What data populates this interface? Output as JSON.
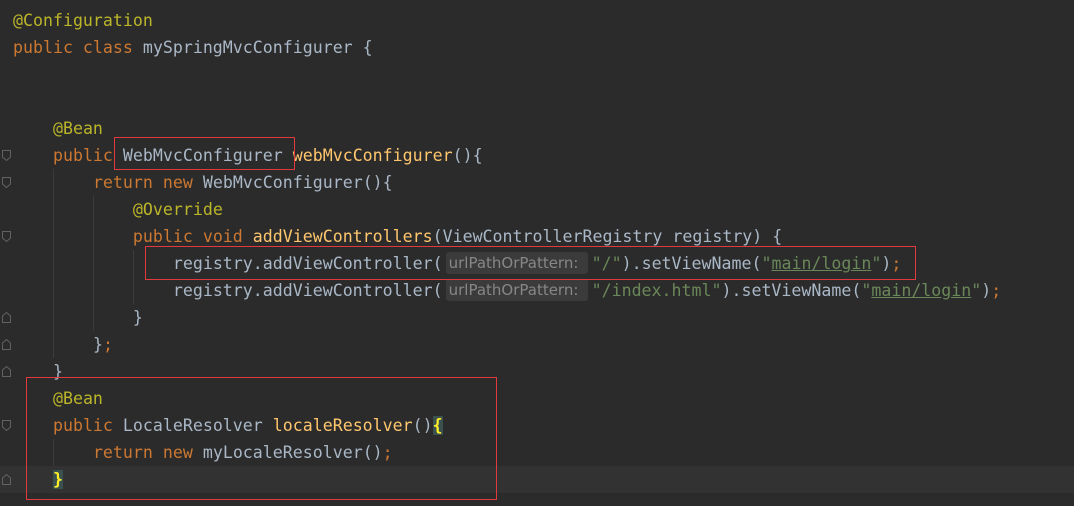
{
  "theme": {
    "background": "#2B2B2B",
    "caret_line": "#323232",
    "plain": "#A9B7C6",
    "keyword": "#CC7832",
    "annotation": "#BBB529",
    "method": "#FFC66D",
    "string": "#6A8759",
    "semicolon": "#CC7832",
    "hint_text": "#878787",
    "hint_bg": "#3B3B3B",
    "brace_text": "#FFEF28",
    "brace_bg": "#3B514D",
    "indent_guide": "#3B3B3B",
    "fold_marker": "#5F6265",
    "markup_box": "#E0393E"
  },
  "editor": {
    "lines": [
      {
        "tokens": [
          {
            "annotation": "@Configuration"
          }
        ]
      },
      {
        "tokens": [
          {
            "keyword": "public class "
          },
          {
            "plain": "mySpringMvcConfigurer {"
          }
        ]
      },
      {
        "tokens": []
      },
      {
        "tokens": []
      },
      {
        "tokens": [
          {
            "indent": "    "
          },
          {
            "annotation": "@Bean"
          }
        ]
      },
      {
        "tokens": [
          {
            "indent": "    "
          },
          {
            "keyword": "public "
          },
          {
            "plain": "WebMvcConfigurer "
          },
          {
            "method": "webMvcConfigurer"
          },
          {
            "plain": "(){"
          }
        ]
      },
      {
        "tokens": [
          {
            "indent": "        "
          },
          {
            "keyword": "return new "
          },
          {
            "plain": "WebMvcConfigurer(){"
          }
        ]
      },
      {
        "tokens": [
          {
            "indent": "            "
          },
          {
            "annotation": "@Override"
          }
        ]
      },
      {
        "tokens": [
          {
            "indent": "            "
          },
          {
            "keyword": "public void "
          },
          {
            "method": "addViewControllers"
          },
          {
            "plain": "(ViewControllerRegistry registry) {"
          }
        ]
      },
      {
        "tokens": [
          {
            "indent": "                "
          },
          {
            "plain": "registry.addViewController("
          },
          {
            "hint": "urlPathOrPattern:"
          },
          {
            "string": "\"/\""
          },
          {
            "plain": ").setViewName("
          },
          {
            "string": "\""
          },
          {
            "string_link": "main/login"
          },
          {
            "string": "\""
          },
          {
            "plain": ")"
          },
          {
            "semicolon": ";"
          }
        ]
      },
      {
        "tokens": [
          {
            "indent": "                "
          },
          {
            "plain": "registry.addViewController("
          },
          {
            "hint": "urlPathOrPattern:"
          },
          {
            "string": "\"/index.html\""
          },
          {
            "plain": ").setViewName("
          },
          {
            "string": "\""
          },
          {
            "string_link": "main/login"
          },
          {
            "string": "\""
          },
          {
            "plain": ")"
          },
          {
            "semicolon": ";"
          }
        ]
      },
      {
        "tokens": [
          {
            "indent": "            "
          },
          {
            "plain": "}"
          }
        ]
      },
      {
        "tokens": [
          {
            "indent": "        "
          },
          {
            "plain": "}"
          },
          {
            "semicolon": ";"
          }
        ]
      },
      {
        "tokens": [
          {
            "indent": "    "
          },
          {
            "plain": "}"
          }
        ]
      },
      {
        "tokens": [
          {
            "indent": "    "
          },
          {
            "annotation": "@Bean"
          }
        ]
      },
      {
        "tokens": [
          {
            "indent": "    "
          },
          {
            "keyword": "public "
          },
          {
            "plain": "LocaleResolver "
          },
          {
            "method": "localeResolver"
          },
          {
            "plain": "()"
          },
          {
            "brace": "{"
          }
        ]
      },
      {
        "tokens": [
          {
            "indent": "        "
          },
          {
            "keyword": "return new "
          },
          {
            "plain": "myLocaleResolver()"
          },
          {
            "semicolon": ";"
          }
        ]
      },
      {
        "tokens": [
          {
            "indent": "    "
          },
          {
            "brace": "}"
          }
        ]
      }
    ]
  }
}
